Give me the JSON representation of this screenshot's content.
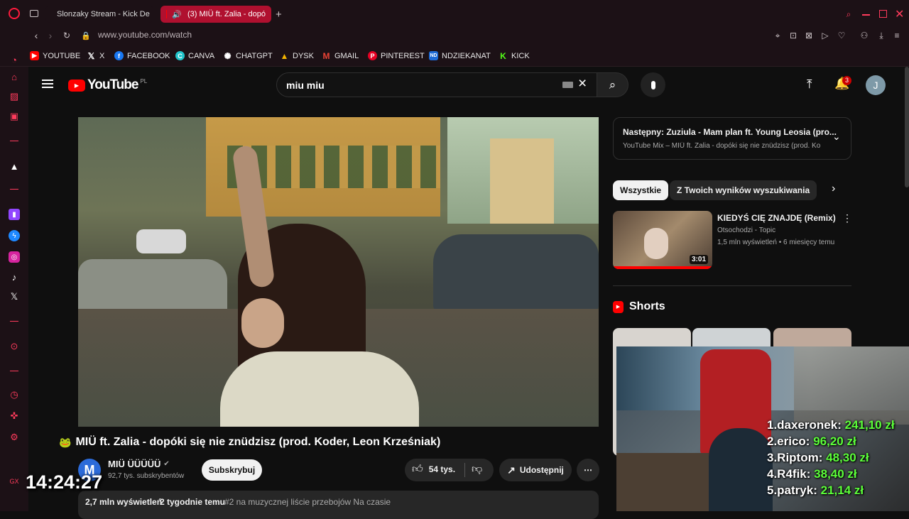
{
  "browser": {
    "tabs": [
      {
        "title": "Slonzaky Stream - Kick De",
        "icon": "kick-icon",
        "active": false
      },
      {
        "title": "(3) MIÜ ft. Zalia - dopó",
        "icon": "youtube-icon",
        "active": true
      }
    ],
    "url": "www.youtube.com/watch",
    "bookmarks": [
      {
        "label": "YOUTUBE",
        "icon": "youtube-icon",
        "color": "#ff0000"
      },
      {
        "label": "X",
        "icon": "x-icon",
        "color": "#000000"
      },
      {
        "label": "FACEBOOK",
        "icon": "facebook-icon",
        "color": "#1877f2"
      },
      {
        "label": "CANVA",
        "icon": "canva-icon",
        "color": "#20c4cb"
      },
      {
        "label": "CHATGPT",
        "icon": "chatgpt-icon",
        "color": "#444444"
      },
      {
        "label": "DYSK",
        "icon": "drive-icon",
        "color": "#f4b400"
      },
      {
        "label": "GMAIL",
        "icon": "gmail-icon",
        "color": "#ea4335"
      },
      {
        "label": "PINTEREST",
        "icon": "pinterest-icon",
        "color": "#e60023"
      },
      {
        "label": "NDZIEKANAT",
        "icon": "nd-icon",
        "color": "#1e6bd6"
      },
      {
        "label": "KICK",
        "icon": "kick-icon",
        "color": "#53fc18"
      }
    ]
  },
  "youtube": {
    "logo_text": "YouTube",
    "region": "PL",
    "search_value": "miu miu",
    "notification_count": "3",
    "avatar_letter": "J",
    "video": {
      "title": "MIÜ ft. Zalia - dopóki się nie znüdzisz (prod. Koder, Leon Krześniak)",
      "channel": "MIÜ ÜÜÜÜÜ",
      "subscribers": "92,7 tys. subskrybentów",
      "subscribe_label": "Subskrybuj",
      "likes": "54 tys.",
      "share_label": "Udostępnij",
      "views": "2,7 mln wyświetleń",
      "age": "2 tygodnie temu",
      "tags": "#2 na muzycznej liście przebojów Na czasie"
    },
    "up_next": {
      "title": "Następny: Zuziula - Mam plan ft. Young Leosia (pro...",
      "subtitle": "YouTube Mix – MIÜ ft. Zalia - dopóki się nie znüdzisz (prod. Ko"
    },
    "chips": [
      "Wszystkie",
      "Z Twoich wyników wyszukiwania"
    ],
    "recommended": {
      "title": "KIEDYŚ CIĘ ZNAJDĘ (Remix)",
      "channel": "Otsochodzi - Topic",
      "meta": "1,5 mln wyświetleń • 6 miesięcy temu",
      "duration": "3:01"
    },
    "shorts_label": "Shorts"
  },
  "overlay": {
    "clock": "14:24:27",
    "leaderboard": [
      {
        "name": "1.daxeronek:",
        "amount": "241,10 zł"
      },
      {
        "name": "2.erico:",
        "amount": "96,20 zł"
      },
      {
        "name": "3.Riptom:",
        "amount": "48,30 zł"
      },
      {
        "name": "4.R4fik:",
        "amount": "38,40 zł"
      },
      {
        "name": "5.patryk:",
        "amount": "21,14 zł"
      }
    ]
  },
  "colors": {
    "accent_red": "#ff0000",
    "browser_bg": "#1c1116",
    "active_tab": "#b0102f",
    "donation_green": "#5cff3a"
  }
}
